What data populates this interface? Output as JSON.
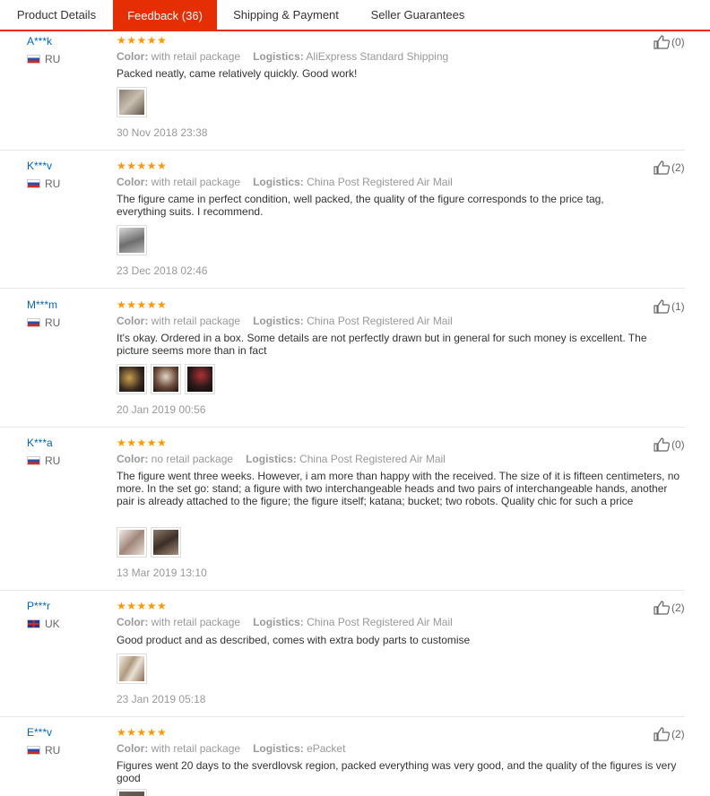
{
  "tabs": [
    {
      "label": "Product Details"
    },
    {
      "label": "Feedback (36)"
    },
    {
      "label": "Shipping & Payment"
    },
    {
      "label": "Seller Guarantees"
    }
  ],
  "colors": {
    "accent": "#e62e04",
    "star": "#ff9900",
    "buyer_link": "#0066bb"
  },
  "icons": {
    "helpful": "thumbs-up-icon",
    "star": "star-icon",
    "flag": "flag-icon"
  },
  "labels": {
    "color": "Color:",
    "logistics": "Logistics:"
  },
  "stars_text": "★★★★★",
  "reviews": [
    {
      "buyer": "A***k",
      "country": "RU",
      "rating": 5,
      "color": "with retail package",
      "logistics": "AliExpress Standard Shipping",
      "text": "Packed neatly, came relatively quickly. Good work!",
      "photo_count": 1,
      "date": "30 Nov 2018 23:38",
      "helpful": "(0)"
    },
    {
      "buyer": "K***v",
      "country": "RU",
      "rating": 5,
      "color": "with retail package",
      "logistics": "China Post Registered Air Mail",
      "text": "The figure came in perfect condition, well packed, the quality of the figure corresponds to the price tag, everything suits. I recommend.",
      "photo_count": 1,
      "date": "23 Dec 2018 02:46",
      "helpful": "(2)"
    },
    {
      "buyer": "M***m",
      "country": "RU",
      "rating": 5,
      "color": "with retail package",
      "logistics": "China Post Registered Air Mail",
      "text": "It's okay. Ordered in a box. Some details are not perfectly drawn but in general for such money is excellent. The picture seems more than in fact",
      "photo_count": 3,
      "date": "20 Jan 2019 00:56",
      "helpful": "(1)"
    },
    {
      "buyer": "K***a",
      "country": "RU",
      "rating": 5,
      "color": "no retail package",
      "logistics": "China Post Registered Air Mail",
      "text": "The figure went three weeks. However, i am more than happy with the received. The size of it is fifteen centimeters, no more. In the set go: stand; a figure with two interchangeable heads and two pairs of interchangeable hands, another pair is already attached to the figure; the figure itself; katana; bucket; two robots. Quality chic for such a price",
      "photo_count": 2,
      "date": "13 Mar 2019 13:10",
      "helpful": "(0)"
    },
    {
      "buyer": "P***r",
      "country": "UK",
      "rating": 5,
      "color": "with retail package",
      "logistics": "China Post Registered Air Mail",
      "text": "Good product and as described, comes with extra body parts to customise",
      "photo_count": 1,
      "date": "23 Jan 2019 05:18",
      "helpful": "(2)"
    },
    {
      "buyer": "E***v",
      "country": "RU",
      "rating": 5,
      "color": "with retail package",
      "logistics": "ePacket",
      "text": "Figures went 20 days to the sverdlovsk region, packed everything was very good, and the quality of the figures is very good",
      "photo_count": 1,
      "date": "",
      "helpful": "(2)"
    }
  ]
}
